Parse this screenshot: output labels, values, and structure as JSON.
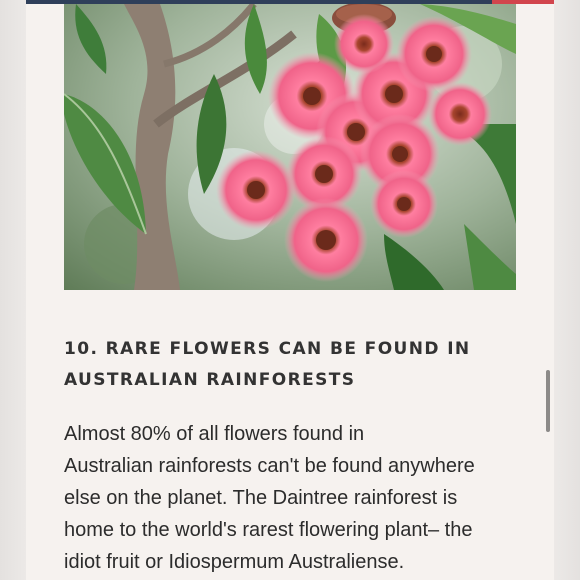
{
  "article": {
    "image": {
      "icon": "flowering-gum-photo",
      "colors": {
        "blossom": "#ef5f86",
        "leaf": "#3f7d3a",
        "trunk": "#8e7f72"
      }
    },
    "heading": {
      "line1": "10. RARE FLOWERS CAN BE FOUND IN",
      "line2": "AUSTRALIAN RAINFORESTS"
    },
    "body": {
      "line1": "Almost 80% of all flowers found in",
      "line2": "Australian rainforests can't be found anywhere",
      "line3": "else on the planet. The Daintree rainforest is",
      "line4": "home to the world's rarest flowering plant– the",
      "line5": "idiot fruit or Idiospermum Australiense."
    }
  },
  "theme": {
    "page_background": "#f6f2ef",
    "top_bar": "#2f3f5a",
    "top_bar_accent": "#d2454d"
  }
}
